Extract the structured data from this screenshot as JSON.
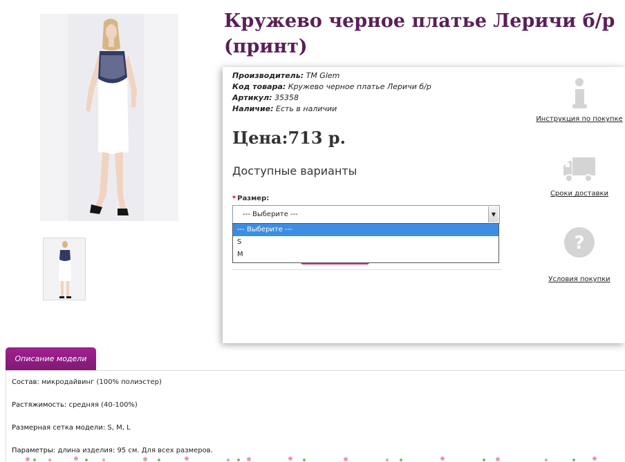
{
  "product": {
    "title": "Кружево черное платье Леричи б/р (принт)",
    "meta": {
      "manufacturer_label": "Производитель:",
      "manufacturer_value": "ТМ Glem",
      "code_label": "Код товара:",
      "code_value": "Кружево черное платье Леричи б/р",
      "article_label": "Артикул:",
      "article_value": "35358",
      "availability_label": "Наличие:",
      "availability_value": "Есть в наличии"
    },
    "price": "Цена:713 р.",
    "variants_heading": "Доступные варианты",
    "size_label": "Размер:",
    "size_required_mark": "*",
    "size_select": {
      "value": "--- Выберите ---",
      "options": [
        "--- Выберите ---",
        "S",
        "M"
      ],
      "highlighted": "--- Выберите ---"
    }
  },
  "side_links": [
    {
      "icon": "info-icon",
      "label": "Инструкция по покупке"
    },
    {
      "icon": "truck-icon",
      "label": "Сроки доставки"
    },
    {
      "icon": "question-icon",
      "label": "Условия покупки"
    }
  ],
  "tabs": {
    "description_tab": "Описание модели"
  },
  "description": {
    "composition_label": "Состав:",
    "composition_value": "микродайвинг (100% полиэстер)",
    "stretch_label": "Растяжимость:",
    "stretch_value": "средняя (40-100%)",
    "sizes_label": "Размерная сетка модели:",
    "sizes_value": "S, M, L",
    "params_label": "Параметры:",
    "params_value": "длина изделия: 95 см. Для всех размеров."
  },
  "colors": {
    "title": "#5a1f58",
    "tab": "#8e1c82",
    "select_highlight": "#3d8ee3",
    "button": "#d62b84"
  }
}
